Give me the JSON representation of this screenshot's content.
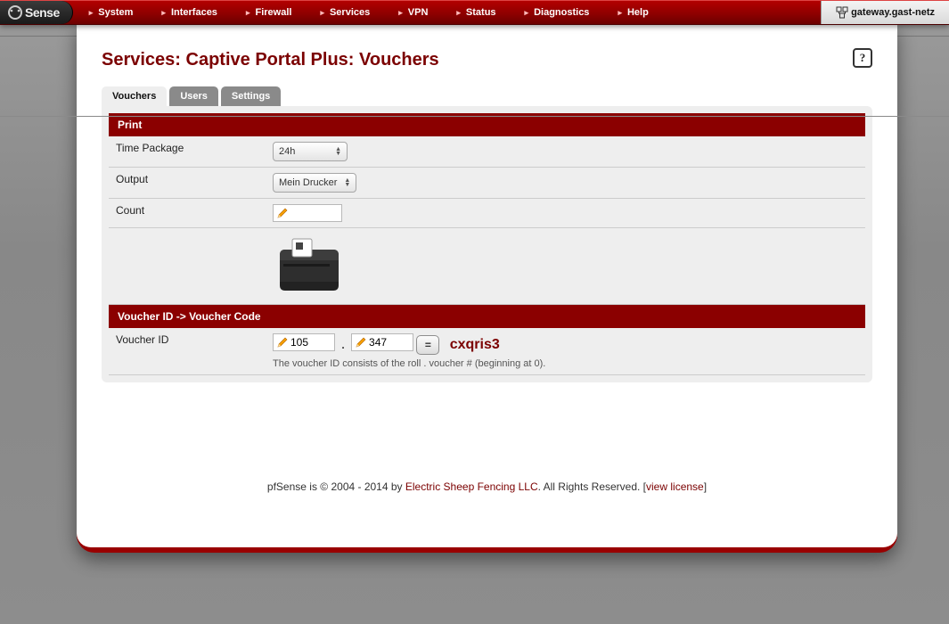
{
  "logo": "Sense",
  "nav": [
    "System",
    "Interfaces",
    "Firewall",
    "Services",
    "VPN",
    "Status",
    "Diagnostics",
    "Help"
  ],
  "host": "gateway.gast-netz",
  "title": "Services: Captive Portal Plus: Vouchers",
  "tabs": [
    "Vouchers",
    "Users",
    "Settings"
  ],
  "active_tab": 0,
  "print": {
    "header": "Print",
    "time_label": "Time Package",
    "time_value": "24h",
    "output_label": "Output",
    "output_value": "Mein Drucker",
    "count_label": "Count",
    "count_value": ""
  },
  "lookup": {
    "header": "Voucher ID -> Voucher Code",
    "id_label": "Voucher ID",
    "roll": "105",
    "num": "347",
    "eq": "=",
    "code": "cxqris3",
    "hint": "The voucher ID consists of the roll . voucher # (beginning at 0)."
  },
  "footer": {
    "pre": "pfSense is © 2004 - 2014 by ",
    "link1": "Electric Sheep Fencing LLC",
    "mid": ". All Rights Reserved. [",
    "link2": "view license",
    "post": "]"
  }
}
